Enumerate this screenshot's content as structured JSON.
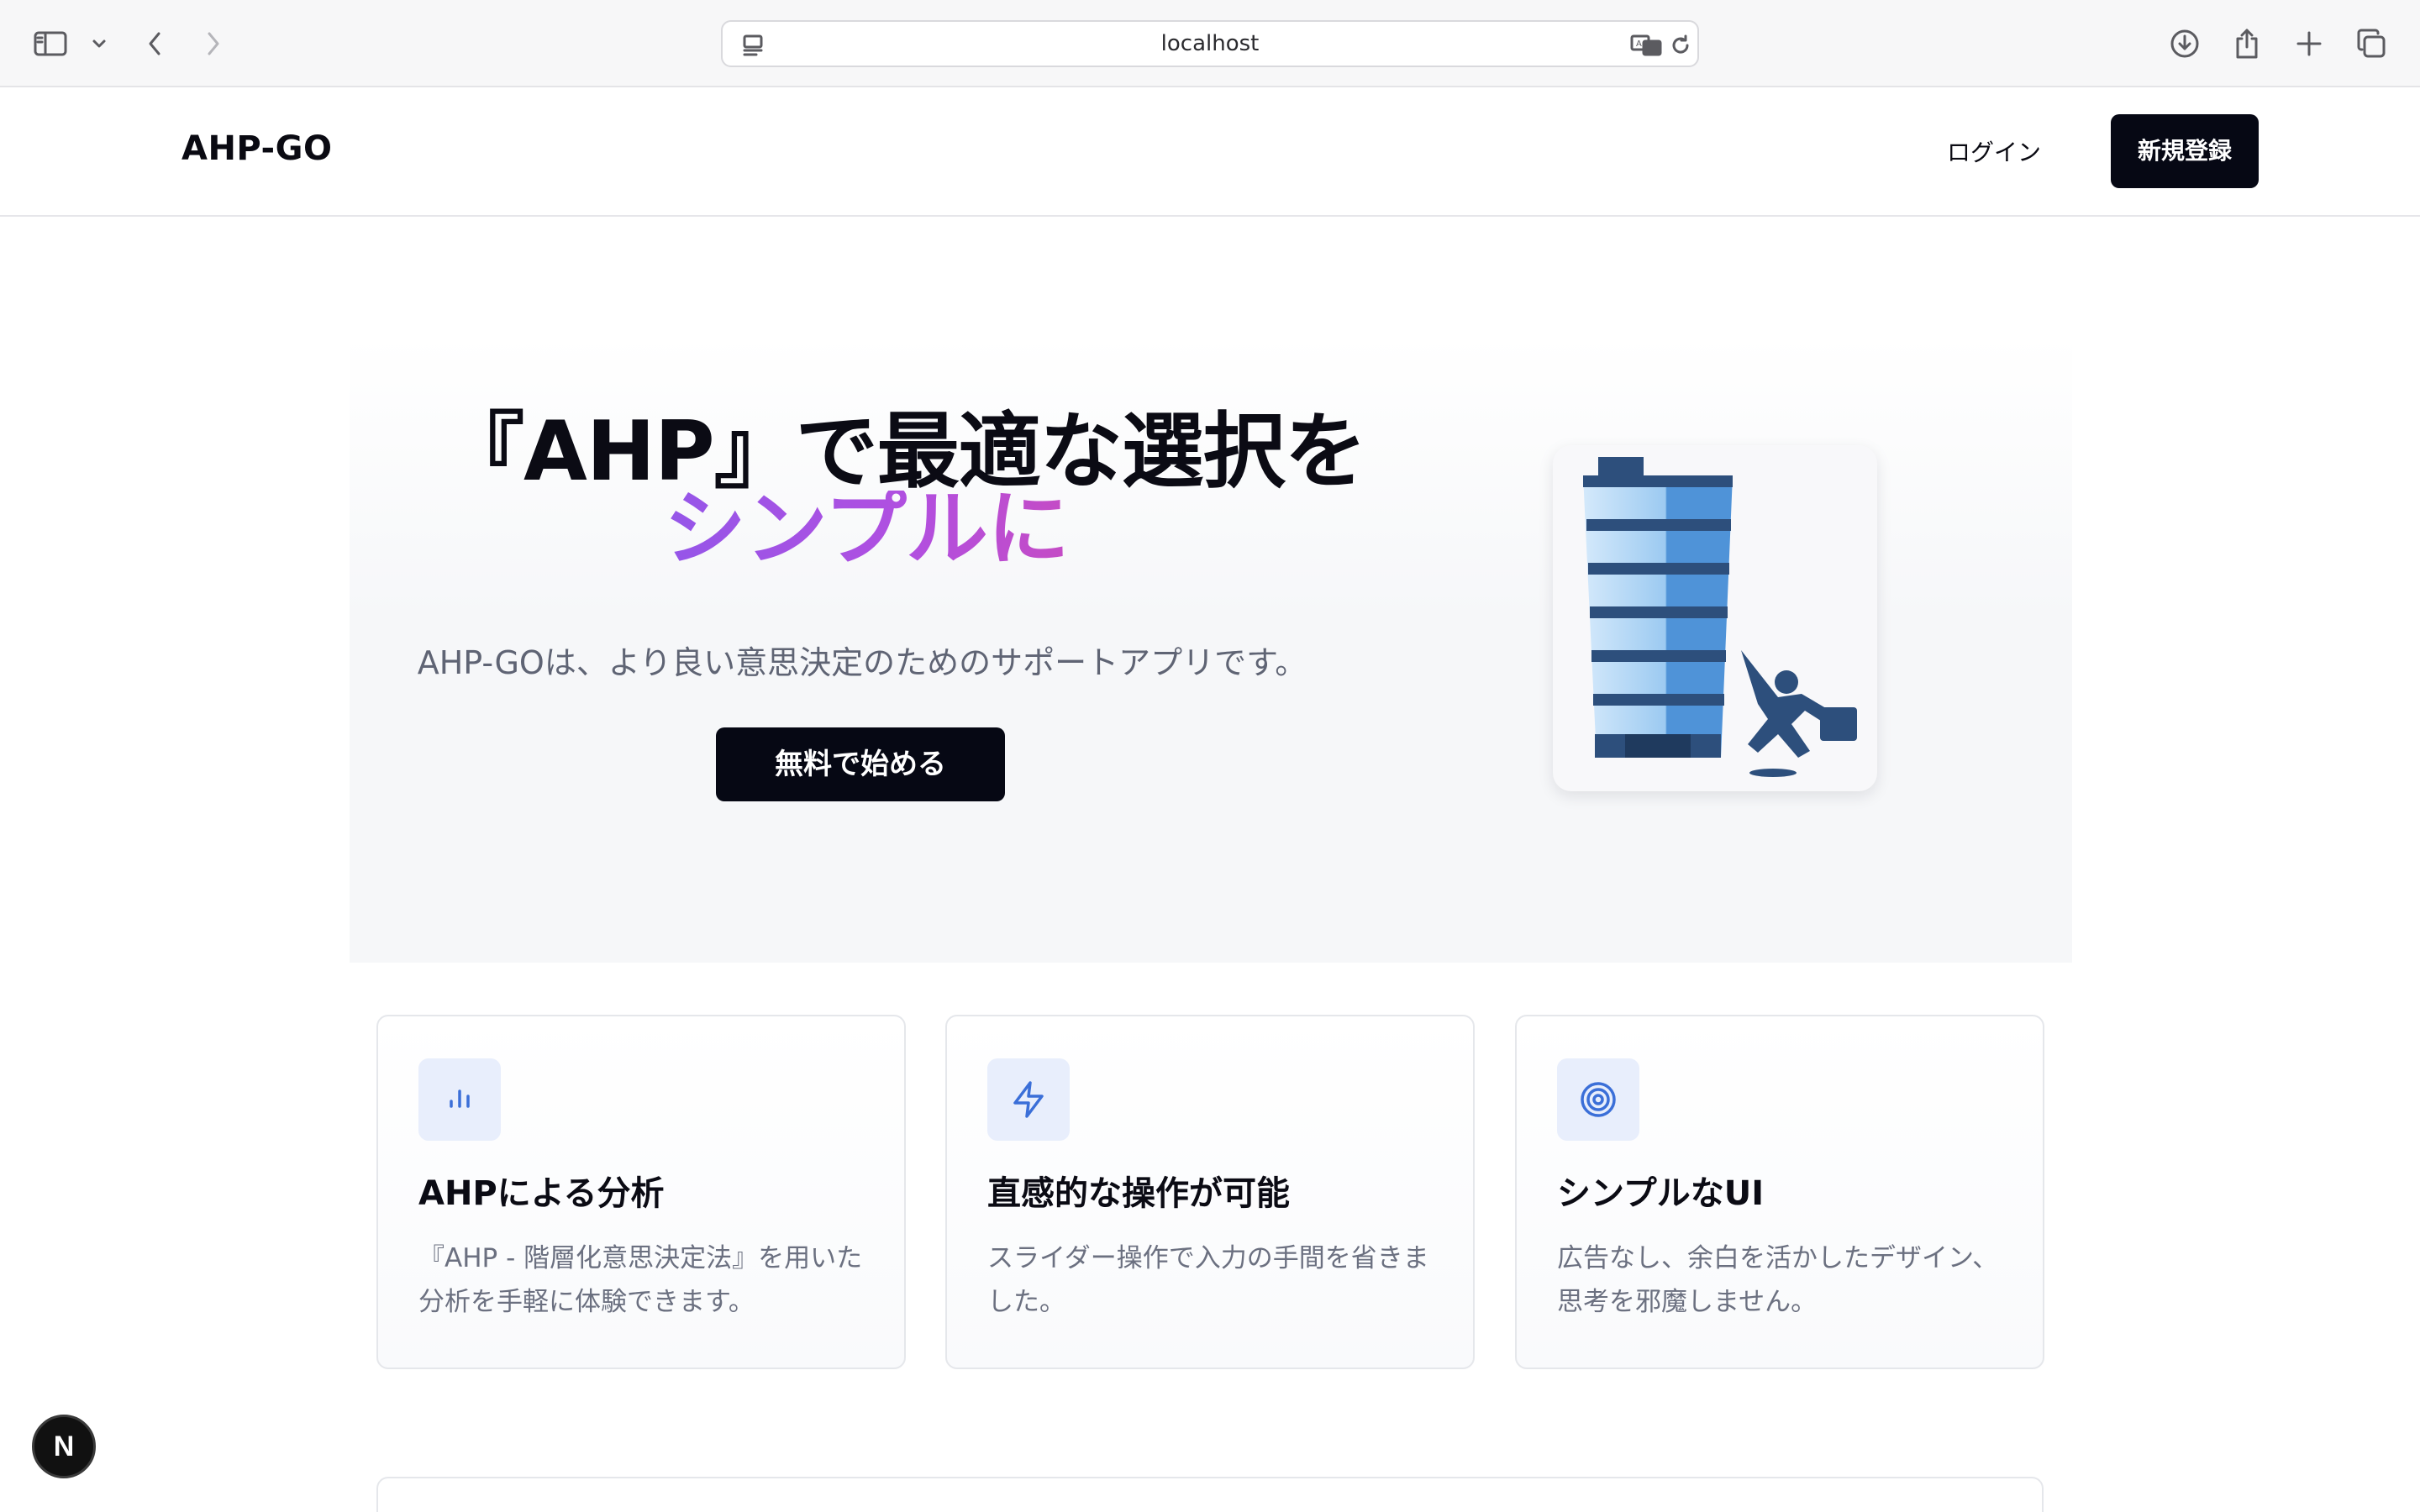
{
  "browser": {
    "url": "localhost",
    "icons": [
      "sidebar-icon",
      "chevron-down-icon",
      "back-icon",
      "forward-icon",
      "site-settings-icon",
      "translate-icon",
      "reload-icon",
      "download-icon",
      "share-icon",
      "new-tab-icon",
      "tabs-overview-icon"
    ]
  },
  "header": {
    "logo": "AHP-GO",
    "login_label": "ログイン",
    "signup_label": "新規登録"
  },
  "hero": {
    "title_line1": "『AHP』で最適な選択を",
    "title_line2": "シンプルに",
    "subtitle": "AHP-GOは、より良い意思決定のためのサポートアプリです。",
    "cta_label": "無料で始める",
    "gradient_colors": [
      "#7b5cf0",
      "#b14fe0",
      "#e0479f"
    ]
  },
  "features": [
    {
      "icon": "bar-chart-icon",
      "title": "AHPによる分析",
      "description": "『AHP - 階層化意思決定法』を用いた分析を手軽に体験できます。"
    },
    {
      "icon": "lightning-icon",
      "title": "直感的な操作が可能",
      "description": "スライダー操作で入力の手間を省きました。"
    },
    {
      "icon": "target-icon",
      "title": "シンプルなUI",
      "description": "広告なし、余白を活かしたデザイン、思考を邪魔しません。"
    }
  ],
  "dev_badge": "N",
  "colors": {
    "primary_button": "#060814",
    "accent_blue": "#3b6fd8",
    "icon_badge_bg": "#e8eefc"
  }
}
